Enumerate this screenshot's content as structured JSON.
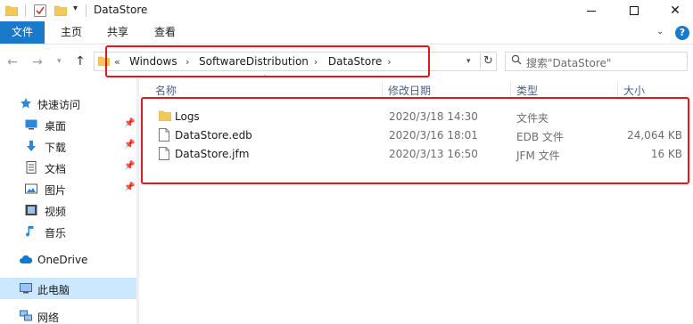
{
  "window": {
    "title": "DataStore",
    "minimize_icon": "minimize-icon",
    "maximize_icon": "maximize-icon",
    "close_label": "✕"
  },
  "ribbon": {
    "tabs": [
      "文件",
      "主页",
      "共享",
      "查看"
    ],
    "help_label": "?"
  },
  "nav": {
    "breadcrumbs": [
      "Windows",
      "SoftwareDistribution",
      "DataStore"
    ],
    "search_placeholder": "搜索\"DataStore\""
  },
  "sidebar": {
    "items": [
      {
        "label": "快速访问",
        "icon": "star-icon",
        "pinned": false
      },
      {
        "label": "桌面",
        "icon": "desktop-icon",
        "pinned": true
      },
      {
        "label": "下载",
        "icon": "download-icon",
        "pinned": true
      },
      {
        "label": "文档",
        "icon": "document-icon",
        "pinned": true
      },
      {
        "label": "图片",
        "icon": "picture-icon",
        "pinned": true
      },
      {
        "label": "视频",
        "icon": "video-icon",
        "pinned": false
      },
      {
        "label": "音乐",
        "icon": "music-icon",
        "pinned": false
      },
      {
        "label": "OneDrive",
        "icon": "cloud-icon",
        "pinned": false
      },
      {
        "label": "此电脑",
        "icon": "computer-icon",
        "pinned": false
      },
      {
        "label": "网络",
        "icon": "network-icon",
        "pinned": false
      }
    ]
  },
  "columns": {
    "name": "名称",
    "date": "修改日期",
    "type": "类型",
    "size": "大小"
  },
  "files": [
    {
      "name": "Logs",
      "date": "2020/3/18 14:30",
      "type": "文件夹",
      "size": "",
      "icon": "folder-icon"
    },
    {
      "name": "DataStore.edb",
      "date": "2020/3/16 18:01",
      "type": "EDB 文件",
      "size": "24,064 KB",
      "icon": "file-icon"
    },
    {
      "name": "DataStore.jfm",
      "date": "2020/3/13 16:50",
      "type": "JFM 文件",
      "size": "16 KB",
      "icon": "file-icon"
    }
  ],
  "colors": {
    "accent": "#1979ca",
    "highlight": "#e8161b",
    "selected": "#cce8ff",
    "folder": "#f2c75c"
  }
}
